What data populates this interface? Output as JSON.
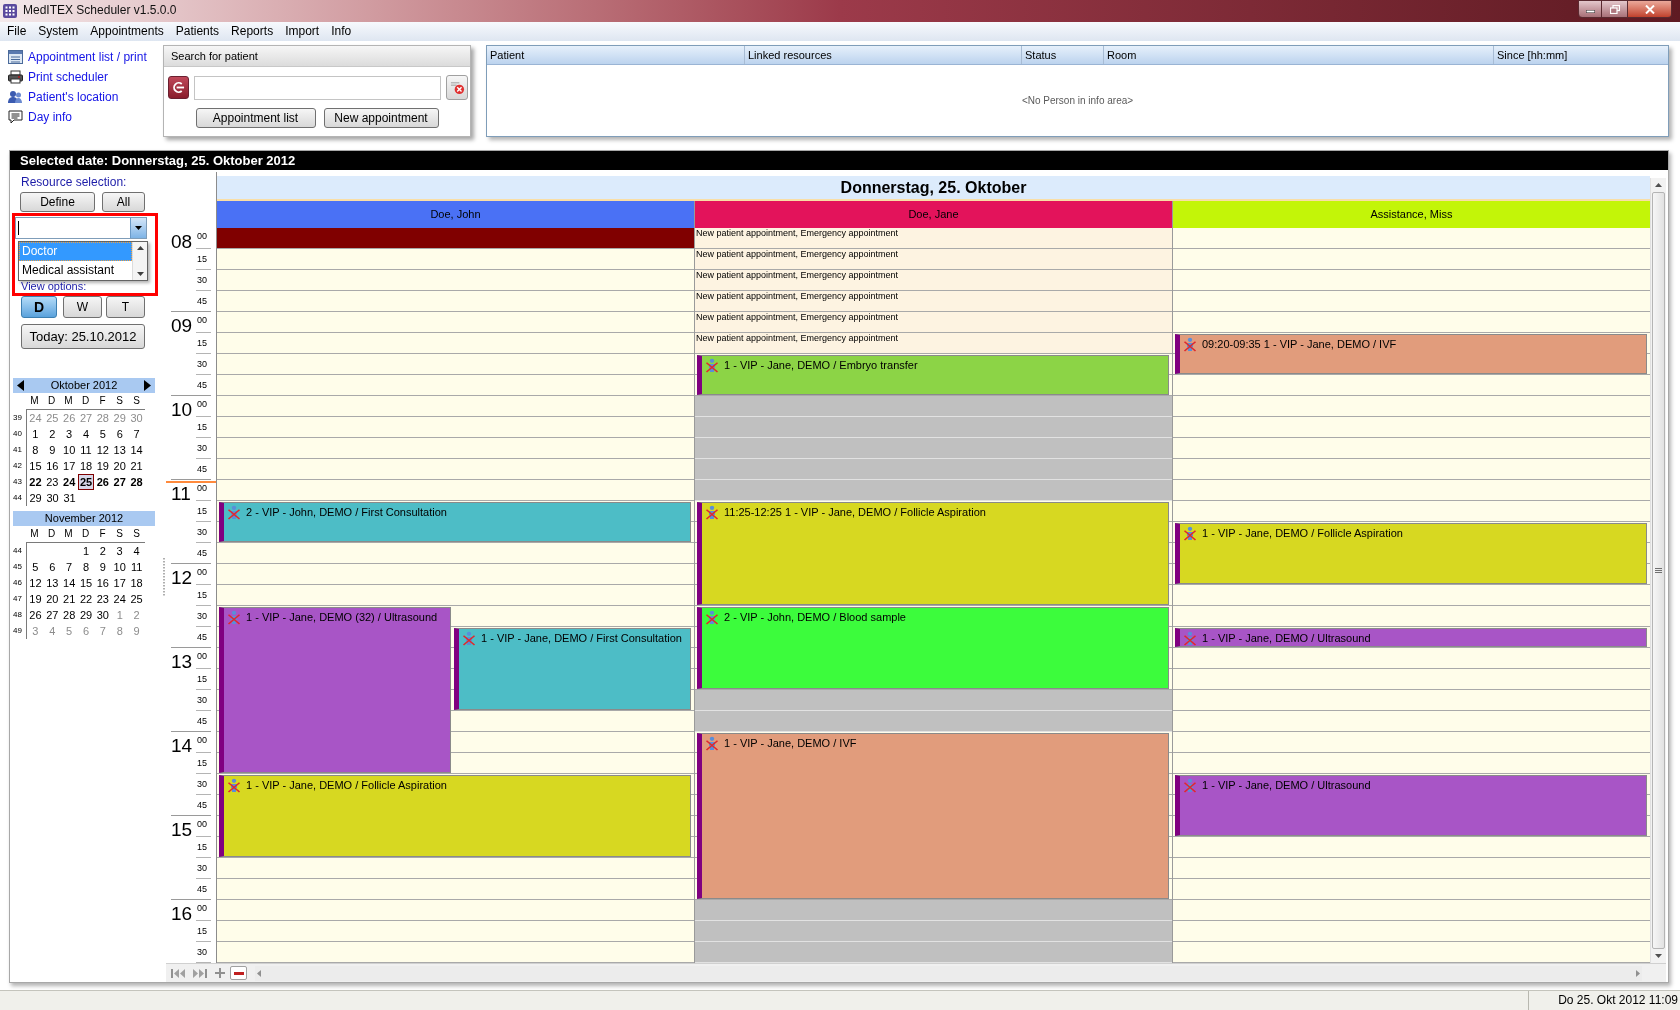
{
  "window": {
    "title": "MedITEX Scheduler v1.5.0.0"
  },
  "menu": [
    "File",
    "System",
    "Appointments",
    "Patients",
    "Reports",
    "Import",
    "Info"
  ],
  "quick_links": [
    {
      "kind": "list",
      "label": "Appointment list / print"
    },
    {
      "kind": "printer",
      "label": "Print scheduler"
    },
    {
      "kind": "location",
      "label": "Patient's location"
    },
    {
      "kind": "note",
      "label": "Day info"
    }
  ],
  "patient_search": {
    "title": "Search for patient",
    "buttons": [
      "Appointment list",
      "New appointment"
    ]
  },
  "info_area": {
    "columns": [
      "Patient",
      "Linked resources",
      "Status",
      "Room",
      "Since [hh:mm]"
    ],
    "empty_text": "<No Person in info area>"
  },
  "selected_date": "Selected date: Donnerstag, 25. Oktober 2012",
  "sidebar": {
    "resource_label": "Resource selection:",
    "resource_buttons": [
      "Define",
      "All"
    ],
    "resource_combo": {
      "expanded": true,
      "options": [
        {
          "label": "Doctor",
          "selected": true
        },
        {
          "label": "Medical assistant",
          "selected": false
        }
      ]
    },
    "view_label": "View options:",
    "view_modes": [
      {
        "label": "D",
        "selected": true
      },
      {
        "label": "W",
        "selected": false
      },
      {
        "label": "T",
        "selected": false
      }
    ],
    "today_button": "Today: 25.10.2012",
    "months": [
      {
        "title": "Oktober 2012",
        "arrows": true,
        "weekdays": [
          "M",
          "D",
          "M",
          "D",
          "F",
          "S",
          "S"
        ],
        "weeks": [
          {
            "week": "39",
            "days": [
              {
                "day": "24",
                "other_month": true,
                "bold": false,
                "selected": false
              },
              {
                "day": "25",
                "other_month": true,
                "bold": false,
                "selected": false
              },
              {
                "day": "26",
                "other_month": true,
                "bold": false,
                "selected": false
              },
              {
                "day": "27",
                "other_month": true,
                "bold": false,
                "selected": false
              },
              {
                "day": "28",
                "other_month": true,
                "bold": false,
                "selected": false
              },
              {
                "day": "29",
                "other_month": true,
                "bold": false,
                "selected": false
              },
              {
                "day": "30",
                "other_month": true,
                "bold": false,
                "selected": false
              }
            ]
          },
          {
            "week": "40",
            "days": [
              {
                "day": "1",
                "other_month": false,
                "bold": false,
                "selected": false
              },
              {
                "day": "2",
                "other_month": false,
                "bold": false,
                "selected": false
              },
              {
                "day": "3",
                "other_month": false,
                "bold": false,
                "selected": false
              },
              {
                "day": "4",
                "other_month": false,
                "bold": false,
                "selected": false
              },
              {
                "day": "5",
                "other_month": false,
                "bold": false,
                "selected": false
              },
              {
                "day": "6",
                "other_month": false,
                "bold": false,
                "selected": false
              },
              {
                "day": "7",
                "other_month": false,
                "bold": false,
                "selected": false
              }
            ]
          },
          {
            "week": "41",
            "days": [
              {
                "day": "8",
                "other_month": false,
                "bold": false,
                "selected": false
              },
              {
                "day": "9",
                "other_month": false,
                "bold": false,
                "selected": false
              },
              {
                "day": "10",
                "other_month": false,
                "bold": false,
                "selected": false
              },
              {
                "day": "11",
                "other_month": false,
                "bold": false,
                "selected": false
              },
              {
                "day": "12",
                "other_month": false,
                "bold": false,
                "selected": false
              },
              {
                "day": "13",
                "other_month": false,
                "bold": false,
                "selected": false
              },
              {
                "day": "14",
                "other_month": false,
                "bold": false,
                "selected": false
              }
            ]
          },
          {
            "week": "42",
            "days": [
              {
                "day": "15",
                "other_month": false,
                "bold": false,
                "selected": false
              },
              {
                "day": "16",
                "other_month": false,
                "bold": false,
                "selected": false
              },
              {
                "day": "17",
                "other_month": false,
                "bold": false,
                "selected": false
              },
              {
                "day": "18",
                "other_month": false,
                "bold": false,
                "selected": false
              },
              {
                "day": "19",
                "other_month": false,
                "bold": false,
                "selected": false
              },
              {
                "day": "20",
                "other_month": false,
                "bold": false,
                "selected": false
              },
              {
                "day": "21",
                "other_month": false,
                "bold": false,
                "selected": false
              }
            ]
          },
          {
            "week": "43",
            "days": [
              {
                "day": "22",
                "other_month": false,
                "bold": true,
                "selected": false
              },
              {
                "day": "23",
                "other_month": false,
                "bold": false,
                "selected": false
              },
              {
                "day": "24",
                "other_month": false,
                "bold": true,
                "selected": false
              },
              {
                "day": "25",
                "other_month": false,
                "bold": true,
                "selected": true
              },
              {
                "day": "26",
                "other_month": false,
                "bold": true,
                "selected": false
              },
              {
                "day": "27",
                "other_month": false,
                "bold": true,
                "selected": false
              },
              {
                "day": "28",
                "other_month": false,
                "bold": true,
                "selected": false
              }
            ]
          },
          {
            "week": "44",
            "days": [
              {
                "day": "29",
                "other_month": false,
                "bold": false,
                "selected": false
              },
              {
                "day": "30",
                "other_month": false,
                "bold": false,
                "selected": false
              },
              {
                "day": "31",
                "other_month": false,
                "bold": false,
                "selected": false
              }
            ]
          }
        ]
      },
      {
        "title": "November 2012",
        "arrows": false,
        "weekdays": [
          "M",
          "D",
          "M",
          "D",
          "F",
          "S",
          "S"
        ],
        "weeks": [
          {
            "week": "44",
            "days": [
              {
                "day": "1",
                "other_month": false,
                "bold": false,
                "selected": false
              },
              {
                "day": "2",
                "other_month": false,
                "bold": false,
                "selected": false
              },
              {
                "day": "3",
                "other_month": false,
                "bold": false,
                "selected": false
              },
              {
                "day": "4",
                "other_month": false,
                "bold": false,
                "selected": false
              }
            ]
          },
          {
            "week": "45",
            "days": [
              {
                "day": "5",
                "other_month": false,
                "bold": false,
                "selected": false
              },
              {
                "day": "6",
                "other_month": false,
                "bold": false,
                "selected": false
              },
              {
                "day": "7",
                "other_month": false,
                "bold": false,
                "selected": false
              },
              {
                "day": "8",
                "other_month": false,
                "bold": false,
                "selected": false
              },
              {
                "day": "9",
                "other_month": false,
                "bold": false,
                "selected": false
              },
              {
                "day": "10",
                "other_month": false,
                "bold": false,
                "selected": false
              },
              {
                "day": "11",
                "other_month": false,
                "bold": false,
                "selected": false
              }
            ]
          },
          {
            "week": "46",
            "days": [
              {
                "day": "12",
                "other_month": false,
                "bold": false,
                "selected": false
              },
              {
                "day": "13",
                "other_month": false,
                "bold": false,
                "selected": false
              },
              {
                "day": "14",
                "other_month": false,
                "bold": false,
                "selected": false
              },
              {
                "day": "15",
                "other_month": false,
                "bold": false,
                "selected": false
              },
              {
                "day": "16",
                "other_month": false,
                "bold": false,
                "selected": false
              },
              {
                "day": "17",
                "other_month": false,
                "bold": false,
                "selected": false
              },
              {
                "day": "18",
                "other_month": false,
                "bold": false,
                "selected": false
              }
            ]
          },
          {
            "week": "47",
            "days": [
              {
                "day": "19",
                "other_month": false,
                "bold": false,
                "selected": false
              },
              {
                "day": "20",
                "other_month": false,
                "bold": false,
                "selected": false
              },
              {
                "day": "21",
                "other_month": false,
                "bold": false,
                "selected": false
              },
              {
                "day": "22",
                "other_month": false,
                "bold": false,
                "selected": false
              },
              {
                "day": "23",
                "other_month": false,
                "bold": false,
                "selected": false
              },
              {
                "day": "24",
                "other_month": false,
                "bold": false,
                "selected": false
              },
              {
                "day": "25",
                "other_month": false,
                "bold": false,
                "selected": false
              }
            ]
          },
          {
            "week": "48",
            "days": [
              {
                "day": "26",
                "other_month": false,
                "bold": false,
                "selected": false
              },
              {
                "day": "27",
                "other_month": false,
                "bold": false,
                "selected": false
              },
              {
                "day": "28",
                "other_month": false,
                "bold": false,
                "selected": false
              },
              {
                "day": "29",
                "other_month": false,
                "bold": false,
                "selected": false
              },
              {
                "day": "30",
                "other_month": false,
                "bold": false,
                "selected": false
              },
              {
                "day": "1",
                "other_month": true,
                "bold": false,
                "selected": false
              },
              {
                "day": "2",
                "other_month": true,
                "bold": false,
                "selected": false
              }
            ]
          },
          {
            "week": "49",
            "days": [
              {
                "day": "3",
                "other_month": true,
                "bold": false,
                "selected": false
              },
              {
                "day": "4",
                "other_month": true,
                "bold": false,
                "selected": false
              },
              {
                "day": "5",
                "other_month": true,
                "bold": false,
                "selected": false
              },
              {
                "day": "6",
                "other_month": true,
                "bold": false,
                "selected": false
              },
              {
                "day": "7",
                "other_month": true,
                "bold": false,
                "selected": false
              },
              {
                "day": "8",
                "other_month": true,
                "bold": false,
                "selected": false
              },
              {
                "day": "9",
                "other_month": true,
                "bold": false,
                "selected": false
              }
            ]
          }
        ]
      }
    ]
  },
  "scheduler": {
    "day_title": "Donnerstag, 25. Oktober",
    "resources": [
      {
        "name": "Doe, John",
        "color": "#4a71f5"
      },
      {
        "name": "Doe, Jane",
        "color": "#e3135b"
      },
      {
        "name": "Assistance, Miss",
        "color": "#c3f508"
      }
    ],
    "rows": [
      {
        "hour": "08",
        "minute": "00",
        "now": false,
        "cells": [
          {
            "kind": "reserved",
            "color": "#800000"
          },
          {
            "kind": "note",
            "label": "New patient appointment, Emergency appointment"
          },
          {
            "kind": "free"
          }
        ]
      },
      {
        "minute": "15",
        "now": false,
        "cells": [
          {
            "kind": "free"
          },
          {
            "kind": "note",
            "label": "New patient appointment, Emergency appointment"
          },
          {
            "kind": "free"
          }
        ]
      },
      {
        "minute": "30",
        "now": false,
        "cells": [
          {
            "kind": "free"
          },
          {
            "kind": "note",
            "label": "New patient appointment, Emergency appointment"
          },
          {
            "kind": "free"
          }
        ]
      },
      {
        "minute": "45",
        "now": false,
        "cells": [
          {
            "kind": "free"
          },
          {
            "kind": "note",
            "label": "New patient appointment, Emergency appointment"
          },
          {
            "kind": "free"
          }
        ]
      },
      {
        "hour": "09",
        "minute": "00",
        "now": false,
        "cells": [
          {
            "kind": "free"
          },
          {
            "kind": "note",
            "label": "New patient appointment, Emergency appointment"
          },
          {
            "kind": "free"
          }
        ]
      },
      {
        "minute": "15",
        "now": false,
        "cells": [
          {
            "kind": "free"
          },
          {
            "kind": "note",
            "label": "New patient appointment, Emergency appointment"
          },
          {
            "kind": "free",
            "appointments": [
              {
                "kind": "full",
                "color": "#e19c7c",
                "label": "09:20-09:35 1 - VIP - Jane, DEMO / IVF"
              }
            ]
          }
        ]
      },
      {
        "minute": "30",
        "now": false,
        "cells": [
          {
            "kind": "free"
          },
          {
            "kind": "free",
            "appointments": [
              {
                "kind": "full",
                "color": "#8cd446",
                "label": "1 - VIP - Jane, DEMO / Embryo transfer"
              }
            ]
          },
          {
            "kind": "free",
            "appointments": [
              {
                "kind": "full"
              }
            ]
          }
        ]
      },
      {
        "minute": "45",
        "now": false,
        "cells": [
          {
            "kind": "free"
          },
          {
            "kind": "free",
            "appointments": [
              {
                "kind": "full"
              }
            ]
          },
          {
            "kind": "free"
          }
        ]
      },
      {
        "hour": "10",
        "minute": "00",
        "now": false,
        "cells": [
          {
            "kind": "free"
          },
          {
            "kind": "blocked"
          },
          {
            "kind": "free"
          }
        ]
      },
      {
        "minute": "15",
        "now": false,
        "cells": [
          {
            "kind": "free"
          },
          {
            "kind": "blocked"
          },
          {
            "kind": "free"
          }
        ]
      },
      {
        "minute": "30",
        "now": false,
        "cells": [
          {
            "kind": "free"
          },
          {
            "kind": "blocked"
          },
          {
            "kind": "free"
          }
        ]
      },
      {
        "minute": "45",
        "now": false,
        "cells": [
          {
            "kind": "free"
          },
          {
            "kind": "blocked"
          },
          {
            "kind": "free"
          }
        ]
      },
      {
        "hour": "11",
        "minute": "00",
        "now": true,
        "cells": [
          {
            "kind": "free"
          },
          {
            "kind": "blocked"
          },
          {
            "kind": "free"
          }
        ]
      },
      {
        "minute": "15",
        "now": false,
        "cells": [
          {
            "kind": "free",
            "appointments": [
              {
                "kind": "full",
                "color": "#4dbdc6",
                "label": "2 - VIP - John, DEMO / First Consultation"
              }
            ]
          },
          {
            "kind": "free",
            "appointments": [
              {
                "kind": "full",
                "color": "#d7d821",
                "label": "11:25-12:25 1 - VIP - Jane, DEMO / Follicle Aspiration"
              }
            ]
          },
          {
            "kind": "free"
          }
        ]
      },
      {
        "minute": "30",
        "now": false,
        "cells": [
          {
            "kind": "free",
            "appointments": [
              {
                "kind": "full"
              }
            ]
          },
          {
            "kind": "free",
            "appointments": [
              {
                "kind": "full"
              }
            ]
          },
          {
            "kind": "free",
            "appointments": [
              {
                "kind": "full",
                "color": "#d7d821",
                "label": "1 - VIP - Jane, DEMO / Follicle Aspiration"
              }
            ]
          }
        ]
      },
      {
        "minute": "45",
        "now": false,
        "cells": [
          {
            "kind": "free"
          },
          {
            "kind": "free",
            "appointments": [
              {
                "kind": "full"
              }
            ]
          },
          {
            "kind": "free",
            "appointments": [
              {
                "kind": "full"
              }
            ]
          }
        ]
      },
      {
        "hour": "12",
        "minute": "00",
        "now": false,
        "cells": [
          {
            "kind": "free"
          },
          {
            "kind": "free",
            "appointments": [
              {
                "kind": "full"
              }
            ]
          },
          {
            "kind": "free",
            "appointments": [
              {
                "kind": "full"
              }
            ]
          }
        ]
      },
      {
        "minute": "15",
        "now": false,
        "cells": [
          {
            "kind": "free"
          },
          {
            "kind": "free",
            "appointments": [
              {
                "kind": "full"
              }
            ]
          },
          {
            "kind": "free"
          }
        ]
      },
      {
        "minute": "30",
        "now": false,
        "cells": [
          {
            "kind": "free",
            "appointments": [
              {
                "kind": "left",
                "color": "#a855c6",
                "label": "1 - VIP - Jane, DEMO (32) / Ultrasound"
              }
            ]
          },
          {
            "kind": "free",
            "appointments": [
              {
                "kind": "full",
                "color": "#3cfc3c",
                "label": "2 - VIP - John, DEMO / Blood sample"
              }
            ]
          },
          {
            "kind": "free"
          }
        ]
      },
      {
        "minute": "45",
        "now": false,
        "cells": [
          {
            "kind": "free",
            "appointments": [
              {
                "kind": "left"
              },
              {
                "kind": "right",
                "color": "#4dbdc6",
                "label": "1 - VIP - Jane, DEMO / First Consultation"
              }
            ]
          },
          {
            "kind": "free",
            "appointments": [
              {
                "kind": "full"
              }
            ]
          },
          {
            "kind": "free",
            "appointments": [
              {
                "kind": "full",
                "color": "#a855c6",
                "label": "1 - VIP - Jane, DEMO / Ultrasound"
              }
            ]
          }
        ]
      },
      {
        "hour": "13",
        "minute": "00",
        "now": false,
        "cells": [
          {
            "kind": "free",
            "appointments": [
              {
                "kind": "left"
              },
              {
                "kind": "right"
              }
            ]
          },
          {
            "kind": "free",
            "appointments": [
              {
                "kind": "full"
              }
            ]
          },
          {
            "kind": "free"
          }
        ]
      },
      {
        "minute": "15",
        "now": false,
        "cells": [
          {
            "kind": "free",
            "appointments": [
              {
                "kind": "left"
              },
              {
                "kind": "right"
              }
            ]
          },
          {
            "kind": "free",
            "appointments": [
              {
                "kind": "full"
              }
            ]
          },
          {
            "kind": "free"
          }
        ]
      },
      {
        "minute": "30",
        "now": false,
        "cells": [
          {
            "kind": "free",
            "appointments": [
              {
                "kind": "left"
              },
              {
                "kind": "right"
              }
            ]
          },
          {
            "kind": "blocked"
          },
          {
            "kind": "free"
          }
        ]
      },
      {
        "minute": "45",
        "now": false,
        "cells": [
          {
            "kind": "free",
            "appointments": [
              {
                "kind": "left"
              }
            ]
          },
          {
            "kind": "blocked"
          },
          {
            "kind": "free"
          }
        ]
      },
      {
        "hour": "14",
        "minute": "00",
        "now": false,
        "cells": [
          {
            "kind": "free",
            "appointments": [
              {
                "kind": "left"
              }
            ]
          },
          {
            "kind": "free",
            "appointments": [
              {
                "kind": "full",
                "color": "#e19c7c",
                "label": "1 - VIP - Jane, DEMO / IVF"
              }
            ]
          },
          {
            "kind": "free"
          }
        ]
      },
      {
        "minute": "15",
        "now": false,
        "cells": [
          {
            "kind": "free",
            "appointments": [
              {
                "kind": "left"
              }
            ]
          },
          {
            "kind": "free",
            "appointments": [
              {
                "kind": "full"
              }
            ]
          },
          {
            "kind": "free"
          }
        ]
      },
      {
        "minute": "30",
        "now": false,
        "cells": [
          {
            "kind": "free",
            "appointments": [
              {
                "kind": "full",
                "color": "#d7d821",
                "label": "1 - VIP - Jane, DEMO / Follicle Aspiration"
              }
            ]
          },
          {
            "kind": "free",
            "appointments": [
              {
                "kind": "full"
              }
            ]
          },
          {
            "kind": "free",
            "appointments": [
              {
                "kind": "full",
                "color": "#a855c6",
                "label": "1 - VIP - Jane, DEMO / Ultrasound"
              }
            ]
          }
        ]
      },
      {
        "minute": "45",
        "now": false,
        "cells": [
          {
            "kind": "free",
            "appointments": [
              {
                "kind": "full"
              }
            ]
          },
          {
            "kind": "free",
            "appointments": [
              {
                "kind": "full"
              }
            ]
          },
          {
            "kind": "free",
            "appointments": [
              {
                "kind": "full"
              }
            ]
          }
        ]
      },
      {
        "hour": "15",
        "minute": "00",
        "now": false,
        "cells": [
          {
            "kind": "free",
            "appointments": [
              {
                "kind": "full"
              }
            ]
          },
          {
            "kind": "free",
            "appointments": [
              {
                "kind": "full"
              }
            ]
          },
          {
            "kind": "free",
            "appointments": [
              {
                "kind": "full"
              }
            ]
          }
        ]
      },
      {
        "minute": "15",
        "now": false,
        "cells": [
          {
            "kind": "free",
            "appointments": [
              {
                "kind": "full"
              }
            ]
          },
          {
            "kind": "free",
            "appointments": [
              {
                "kind": "full"
              }
            ]
          },
          {
            "kind": "free"
          }
        ]
      },
      {
        "minute": "30",
        "now": false,
        "cells": [
          {
            "kind": "free"
          },
          {
            "kind": "free",
            "appointments": [
              {
                "kind": "full"
              }
            ]
          },
          {
            "kind": "free"
          }
        ]
      },
      {
        "minute": "45",
        "now": false,
        "cells": [
          {
            "kind": "free"
          },
          {
            "kind": "free",
            "appointments": [
              {
                "kind": "full"
              }
            ]
          },
          {
            "kind": "free"
          }
        ]
      },
      {
        "hour": "16",
        "minute": "00",
        "now": false,
        "cells": [
          {
            "kind": "free"
          },
          {
            "kind": "blocked"
          },
          {
            "kind": "free"
          }
        ]
      },
      {
        "minute": "15",
        "now": false,
        "cells": [
          {
            "kind": "free"
          },
          {
            "kind": "blocked"
          },
          {
            "kind": "free"
          }
        ]
      },
      {
        "minute": "30",
        "now": false,
        "cells": [
          {
            "kind": "free"
          },
          {
            "kind": "blocked"
          },
          {
            "kind": "free"
          }
        ]
      }
    ]
  },
  "status_bar": {
    "datetime": "Do 25. Okt 2012 11:09"
  }
}
